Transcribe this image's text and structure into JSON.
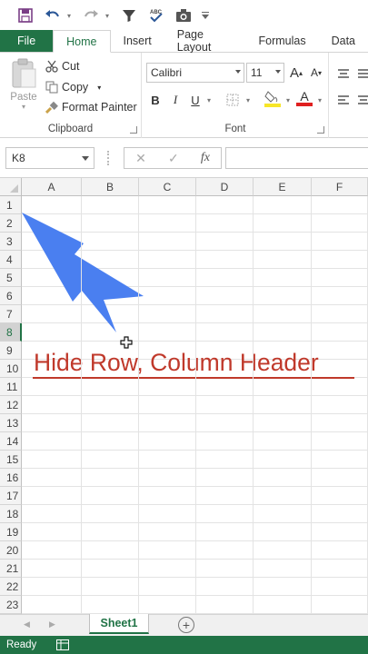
{
  "qat": {
    "icons": [
      "save-icon",
      "undo-icon",
      "redo-icon",
      "filter-icon",
      "spelling-icon",
      "camera-icon",
      "customize-icon"
    ]
  },
  "tabs": [
    {
      "label": "File"
    },
    {
      "label": "Home"
    },
    {
      "label": "Insert"
    },
    {
      "label": "Page Layout"
    },
    {
      "label": "Formulas"
    },
    {
      "label": "Data"
    }
  ],
  "ribbon": {
    "clipboard": {
      "paste_label": "Paste",
      "cut_label": "Cut",
      "copy_label": "Copy",
      "format_painter_label": "Format Painter",
      "group_label": "Clipboard"
    },
    "font": {
      "font_name": "Calibri",
      "font_size": "11",
      "bold": "B",
      "italic": "I",
      "underline": "U",
      "grow_label": "A",
      "shrink_label": "A",
      "font_color_label": "A",
      "group_label": "Font"
    }
  },
  "formula_bar": {
    "name_box": "K8",
    "fx_label": "fx"
  },
  "grid": {
    "columns": [
      "A",
      "B",
      "C",
      "D",
      "E",
      "F"
    ],
    "rows": [
      "1",
      "2",
      "3",
      "4",
      "5",
      "6",
      "7",
      "8",
      "9",
      "10",
      "11",
      "12",
      "13",
      "14",
      "15",
      "16",
      "17",
      "18",
      "19",
      "20",
      "21",
      "22",
      "23"
    ],
    "selected_row": "8",
    "overlay_text": "Hide Row, Column Header"
  },
  "sheets": {
    "active": "Sheet1"
  },
  "status": {
    "text": "Ready"
  },
  "colors": {
    "excel_green": "#217346",
    "arrow_blue": "#4a7ff0",
    "annotation_red": "#c0392b"
  }
}
